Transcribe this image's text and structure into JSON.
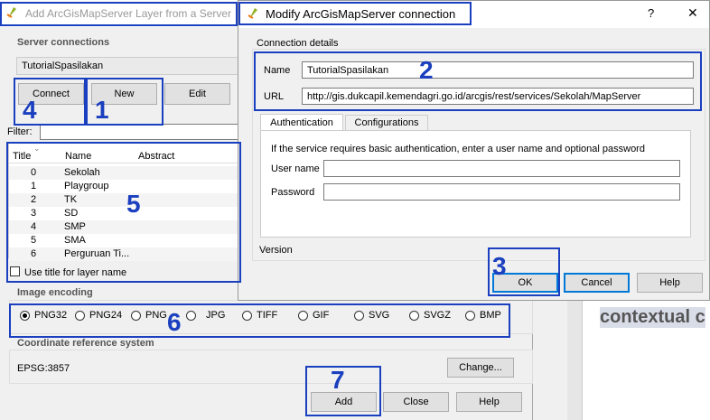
{
  "back_dialog": {
    "title": "Add ArcGisMapServer Layer from a Server",
    "server_connections_label": "Server connections",
    "selected_connection": "TutorialSpasilakan",
    "connect_label": "Connect",
    "new_label": "New",
    "edit_label": "Edit",
    "filter_label": "Filter:",
    "table": {
      "columns": [
        "Title",
        "Name",
        "Abstract"
      ],
      "rows": [
        {
          "title": "0",
          "name": "Sekolah"
        },
        {
          "title": "1",
          "name": "Playgroup"
        },
        {
          "title": "2",
          "name": "TK"
        },
        {
          "title": "3",
          "name": "SD"
        },
        {
          "title": "4",
          "name": "SMP"
        },
        {
          "title": "5",
          "name": "SMA"
        },
        {
          "title": "6",
          "name": "Perguruan Ti..."
        }
      ]
    },
    "use_title_label": "Use title for layer name",
    "image_encoding_label": "Image encoding",
    "encodings": [
      "PNG32",
      "PNG24",
      "PNG",
      "JPG",
      "TIFF",
      "GIF",
      "SVG",
      "SVGZ",
      "BMP"
    ],
    "selected_encoding": "PNG32",
    "crs_label": "Coordinate reference system",
    "crs_value": "EPSG:3857",
    "change_label": "Change...",
    "add_label": "Add",
    "close_label": "Close",
    "help_label": "Help"
  },
  "front_dialog": {
    "title": "Modify ArcGisMapServer connection",
    "help_glyph": "?",
    "close_glyph": "✕",
    "connection_details_label": "Connection details",
    "name_label": "Name",
    "name_value": "TutorialSpasilakan",
    "url_label": "URL",
    "url_value": "http://gis.dukcapil.kemendagri.go.id/arcgis/rest/services/Sekolah/MapServer",
    "tabs": [
      "Authentication",
      "Configurations"
    ],
    "auth_hint": "If the service requires basic authentication, enter a user name and optional password",
    "username_label": "User name",
    "password_label": "Password",
    "version_label": "Version",
    "ok_label": "OK",
    "cancel_label": "Cancel",
    "help_label": "Help"
  },
  "background_text": "contextual c",
  "annotations": [
    "1",
    "2",
    "3",
    "4",
    "5",
    "6",
    "7"
  ],
  "colors": {
    "annotation": "#1a3fbf",
    "focus_blue": "#0078d7"
  }
}
